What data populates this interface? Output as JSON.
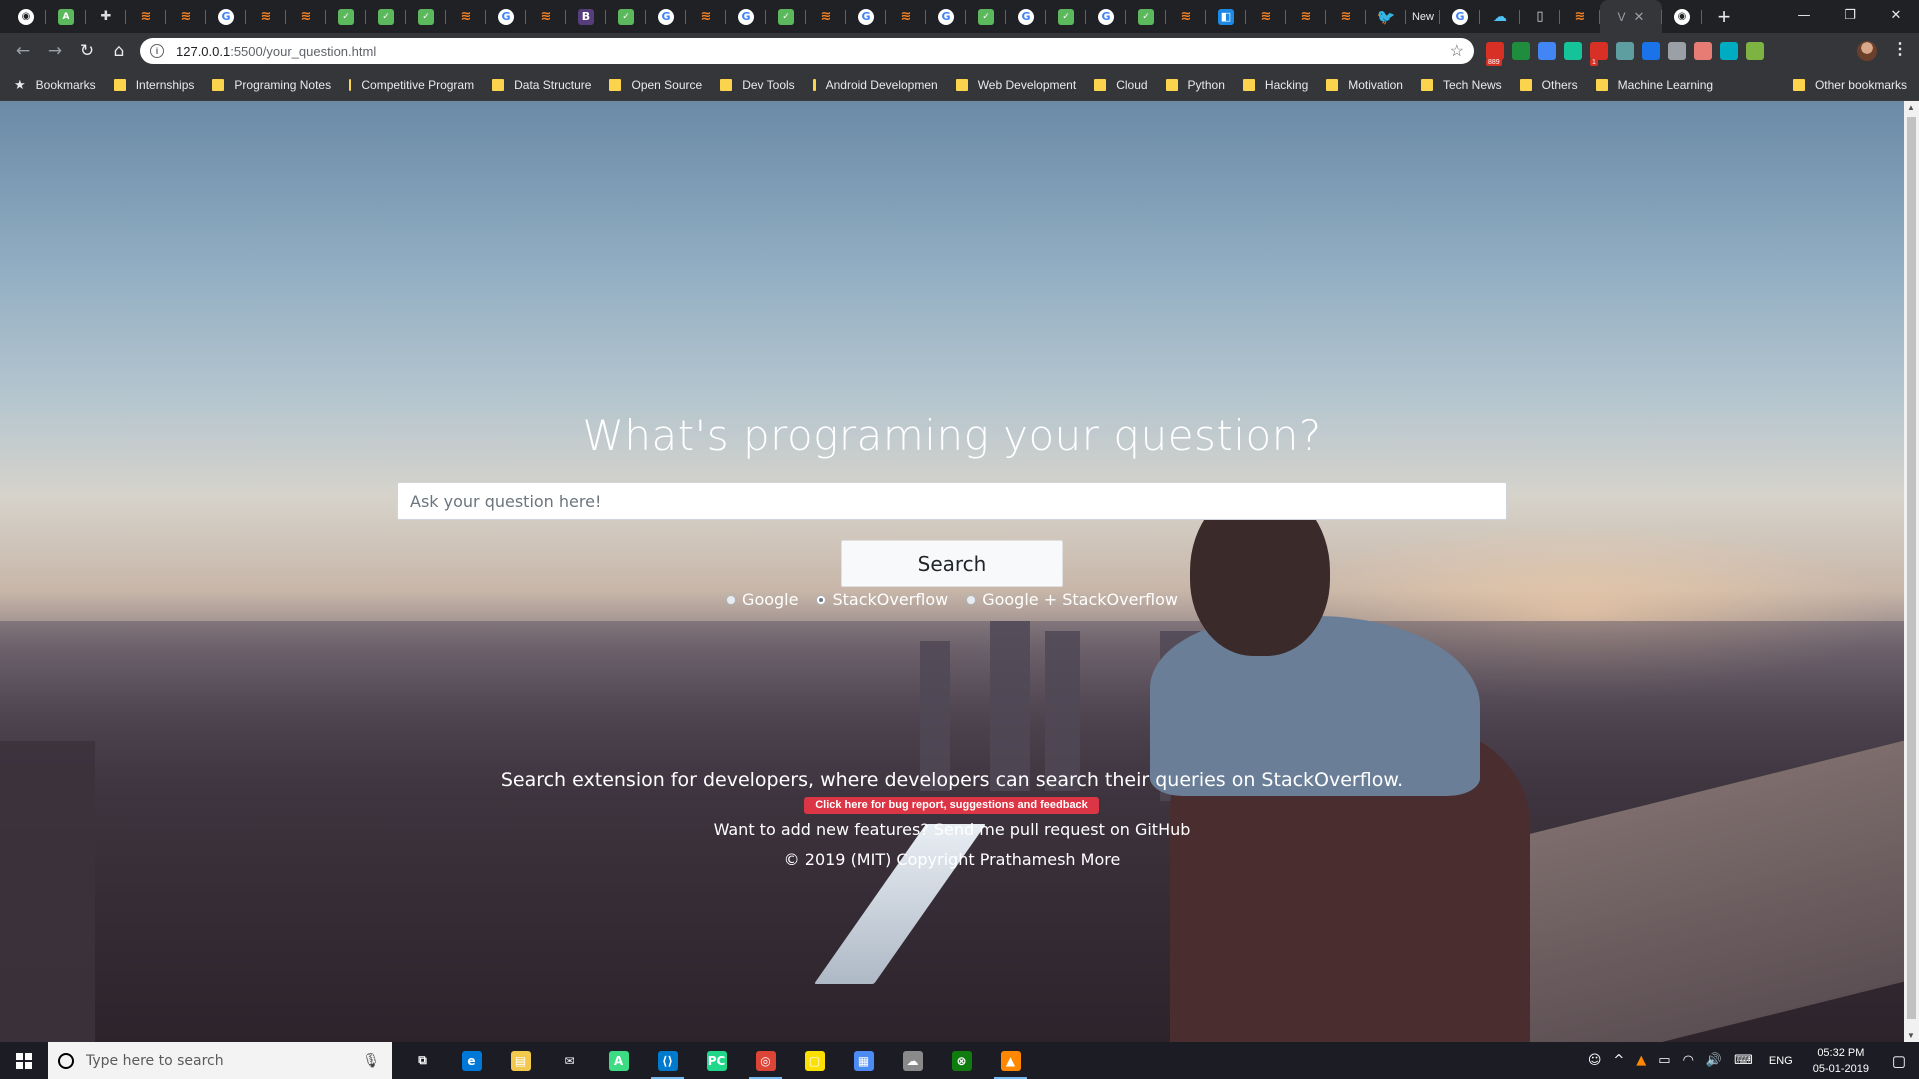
{
  "browser": {
    "tabs": [
      {
        "icon": "github-icon",
        "glyph": "◉",
        "kind": "gh"
      },
      {
        "icon": "android-icon",
        "glyph": "A",
        "kind": "green"
      },
      {
        "icon": "extension-icon",
        "glyph": "✚",
        "kind": "ext"
      },
      {
        "icon": "stackoverflow-icon",
        "glyph": "≋",
        "kind": "so"
      },
      {
        "icon": "stackoverflow-icon",
        "glyph": "≋",
        "kind": "so"
      },
      {
        "icon": "google-icon",
        "glyph": "G",
        "kind": "google"
      },
      {
        "icon": "stackoverflow-icon",
        "glyph": "≋",
        "kind": "so"
      },
      {
        "icon": "stackoverflow-icon",
        "glyph": "≋",
        "kind": "so"
      },
      {
        "icon": "codechef-icon",
        "glyph": "✓",
        "kind": "green"
      },
      {
        "icon": "codechef-icon",
        "glyph": "✓",
        "kind": "green"
      },
      {
        "icon": "codechef-icon",
        "glyph": "✓",
        "kind": "green"
      },
      {
        "icon": "stackoverflow-icon",
        "glyph": "≋",
        "kind": "so"
      },
      {
        "icon": "google-icon",
        "glyph": "G",
        "kind": "google"
      },
      {
        "icon": "stackoverflow-icon",
        "glyph": "≋",
        "kind": "so"
      },
      {
        "icon": "bootstrap-icon",
        "glyph": "B",
        "kind": "boot"
      },
      {
        "icon": "codechef-icon",
        "glyph": "✓",
        "kind": "green"
      },
      {
        "icon": "google-icon",
        "glyph": "G",
        "kind": "google"
      },
      {
        "icon": "stackoverflow-icon",
        "glyph": "≋",
        "kind": "so"
      },
      {
        "icon": "google-icon",
        "glyph": "G",
        "kind": "google"
      },
      {
        "icon": "codechef-icon",
        "glyph": "✓",
        "kind": "green"
      },
      {
        "icon": "stackoverflow-icon",
        "glyph": "≋",
        "kind": "so"
      },
      {
        "icon": "google-icon",
        "glyph": "G",
        "kind": "google"
      },
      {
        "icon": "stackoverflow-icon",
        "glyph": "≋",
        "kind": "so"
      },
      {
        "icon": "google-icon",
        "glyph": "G",
        "kind": "google"
      },
      {
        "icon": "codechef-icon",
        "glyph": "✓",
        "kind": "green"
      },
      {
        "icon": "google-icon",
        "glyph": "G",
        "kind": "google"
      },
      {
        "icon": "codechef-icon",
        "glyph": "✓",
        "kind": "green"
      },
      {
        "icon": "google-icon",
        "glyph": "G",
        "kind": "google"
      },
      {
        "icon": "codechef-icon",
        "glyph": "✓",
        "kind": "green"
      },
      {
        "icon": "stackoverflow-icon",
        "glyph": "≋",
        "kind": "so"
      },
      {
        "icon": "live-server-icon",
        "glyph": "◧",
        "kind": "blue"
      },
      {
        "icon": "stackoverflow-icon",
        "glyph": "≋",
        "kind": "so"
      },
      {
        "icon": "stackoverflow-icon",
        "glyph": "≋",
        "kind": "so"
      },
      {
        "icon": "stackoverflow-icon",
        "glyph": "≋",
        "kind": "so"
      },
      {
        "icon": "twitter-icon",
        "glyph": "🐦",
        "kind": "tw"
      }
    ],
    "text_tab_label": "New",
    "tabs_after": [
      {
        "icon": "google-icon",
        "glyph": "G",
        "kind": "google"
      },
      {
        "icon": "cloud-icon",
        "glyph": "☁",
        "kind": "cloud"
      },
      {
        "icon": "document-icon",
        "glyph": "▯",
        "kind": "doc"
      },
      {
        "icon": "stackoverflow-icon",
        "glyph": "≋",
        "kind": "so"
      }
    ],
    "active_tab_icon": "V",
    "active_tab_close": "✕",
    "last_tab_icon": "◉",
    "new_tab_glyph": "+",
    "window_controls": {
      "minimize": "—",
      "restore": "❐",
      "close": "✕"
    },
    "nav": {
      "back": "←",
      "forward": "→",
      "reload": "↻",
      "home": "⌂"
    },
    "address": {
      "host": "127.0.0.1",
      "path": ":5500/your_question.html",
      "info_glyph": "i",
      "star_glyph": "☆"
    },
    "extensions": [
      {
        "name": "adblock-icon",
        "color": "#d93025",
        "badge": "889"
      },
      {
        "name": "flag-extension-icon",
        "color": "#1e8e3e",
        "badge": ""
      },
      {
        "name": "translate-icon",
        "color": "#4285f4",
        "badge": ""
      },
      {
        "name": "grammarly-icon",
        "color": "#15c39a",
        "badge": ""
      },
      {
        "name": "calendar-extension-icon",
        "color": "#d93025",
        "badge": "1"
      },
      {
        "name": "extension-icon",
        "color": "#5f9ea0",
        "badge": ""
      },
      {
        "name": "window-extension-icon",
        "color": "#1a73e8",
        "badge": ""
      },
      {
        "name": "cloud-extension-icon",
        "color": "#9aa0a6",
        "badge": ""
      },
      {
        "name": "mic-extension-icon",
        "color": "#e67c73",
        "badge": ""
      },
      {
        "name": "m-extension-icon",
        "color": "#00acc1",
        "badge": ""
      },
      {
        "name": "leaf-extension-icon",
        "color": "#7cb342",
        "badge": ""
      }
    ],
    "menu_glyph": "⋮",
    "bookmarks_label": "Bookmarks",
    "bookmark_folders": [
      "Internships",
      "Programing Notes",
      "Competitive Program",
      "Data Structure",
      "Open Source",
      "Dev Tools",
      "Android Developmen",
      "Web Development",
      "Cloud",
      "Python",
      "Hacking",
      "Motivation",
      "Tech News",
      "Others",
      "Machine Learning"
    ],
    "other_bookmarks": "Other bookmarks"
  },
  "page": {
    "headline": "What's programing your question?",
    "search_placeholder": "Ask your question here!",
    "search_button": "Search",
    "options": [
      {
        "label": "Google",
        "checked": false
      },
      {
        "label": "StackOverflow",
        "checked": true
      },
      {
        "label": "Google + StackOverflow",
        "checked": false
      }
    ],
    "tagline": "Search extension for developers, where developers can search their queries on StackOverflow.",
    "feedback_link": "Click here for bug report, suggestions and feedback",
    "contribute_text": "Want to add new features? Send me pull request on GitHub",
    "copyright": "© 2019 (MIT) Copyright Prathamesh More",
    "colors": {
      "feedback_bg": "#dc3545",
      "text": "#ffffff"
    }
  },
  "scrollbar": {
    "up": "▲",
    "down": "▼"
  },
  "taskbar": {
    "search_placeholder": "Type here to search",
    "mic_glyph": "🎙",
    "apps": [
      {
        "name": "task-view-icon",
        "glyph": "⧉",
        "color": "transparent",
        "running": false
      },
      {
        "name": "edge-icon",
        "glyph": "e",
        "color": "#0078d7",
        "running": false
      },
      {
        "name": "file-explorer-icon",
        "glyph": "▤",
        "color": "#f2c94c",
        "running": false
      },
      {
        "name": "mail-icon",
        "glyph": "✉",
        "color": "transparent",
        "running": false
      },
      {
        "name": "android-studio-icon",
        "glyph": "A",
        "color": "#3ddc84",
        "running": false
      },
      {
        "name": "vscode-icon",
        "glyph": "⟨⟩",
        "color": "#007acc",
        "running": true
      },
      {
        "name": "pycharm-icon",
        "glyph": "PC",
        "color": "#21d789",
        "running": false
      },
      {
        "name": "chrome-icon",
        "glyph": "◎",
        "color": "#db4437",
        "running": true
      },
      {
        "name": "sticky-notes-icon",
        "glyph": "▢",
        "color": "#fce100",
        "running": false
      },
      {
        "name": "photos-icon",
        "glyph": "▦",
        "color": "#4c8bf5",
        "running": false
      },
      {
        "name": "cloud-app-icon",
        "glyph": "☁",
        "color": "#8a8a8a",
        "running": false
      },
      {
        "name": "xbox-icon",
        "glyph": "⊗",
        "color": "#107c10",
        "running": false
      },
      {
        "name": "vlc-icon",
        "glyph": "▲",
        "color": "#ff8800",
        "running": true
      }
    ],
    "tray": {
      "people_glyph": "☺",
      "chevron_glyph": "^",
      "vlc_glyph": "▲",
      "battery_glyph": "▭",
      "wifi_glyph": "◠",
      "volume_glyph": "🔊",
      "keyboard_glyph": "⌨",
      "language": "ENG",
      "time": "05:32 PM",
      "date": "05-01-2019",
      "notification_glyph": "▢"
    }
  }
}
